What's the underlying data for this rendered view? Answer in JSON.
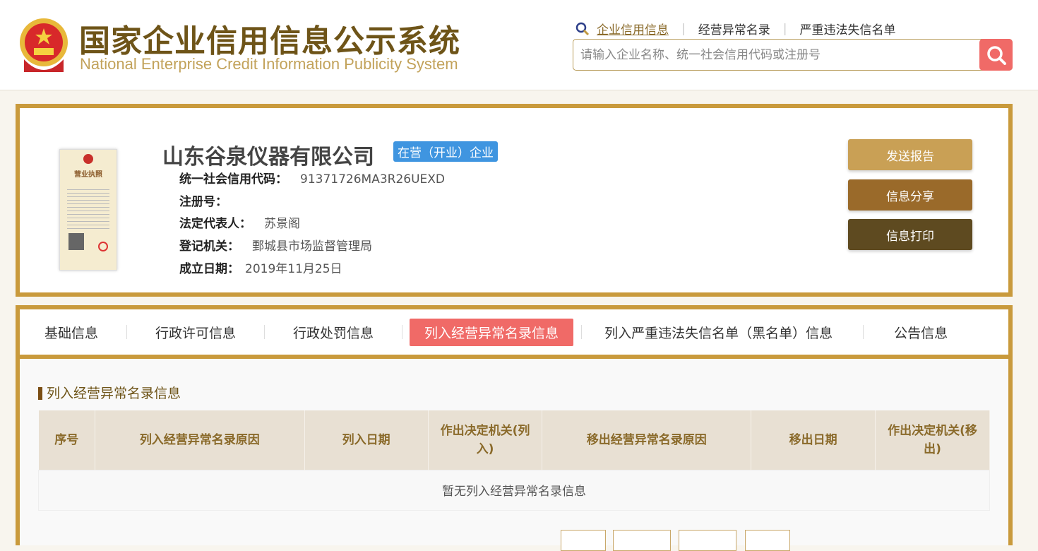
{
  "header": {
    "title_cn": "国家企业信用信息公示系统",
    "title_en": "National Enterprise Credit Information Publicity System",
    "links": [
      "企业信用信息",
      "经营异常名录",
      "严重违法失信名单"
    ],
    "search_placeholder": "请输入企业名称、统一社会信用代码或注册号"
  },
  "company": {
    "name": "山东谷泉仪器有限公司",
    "status": "在营（开业）企业",
    "fields": [
      {
        "label": "统一社会信用代码：",
        "value": "91371726MA3R26UEXD"
      },
      {
        "label": "注册号：",
        "value": ""
      },
      {
        "label": "法定代表人：",
        "value": "苏景阁"
      },
      {
        "label": "登记机关：",
        "value": "鄄城县市场监督管理局"
      },
      {
        "label": "成立日期：",
        "value": "2019年11月25日"
      }
    ],
    "buttons": [
      "发送报告",
      "信息分享",
      "信息打印"
    ],
    "license_title": "营业执照"
  },
  "tabs": [
    "基础信息",
    "行政许可信息",
    "行政处罚信息",
    "列入经营异常名录信息",
    "列入严重违法失信名单（黑名单）信息",
    "公告信息"
  ],
  "section": {
    "title": "列入经营异常名录信息",
    "columns": [
      "序号",
      "列入经营异常名录原因",
      "列入日期",
      "作出决定机关(列入)",
      "移出经营异常名录原因",
      "移出日期",
      "作出决定机关(移出)"
    ],
    "empty": "暂无列入经营异常名录信息"
  },
  "colors": {
    "gold": "#c99a3c",
    "accent": "#f06a67",
    "badge": "#3f95e0"
  }
}
